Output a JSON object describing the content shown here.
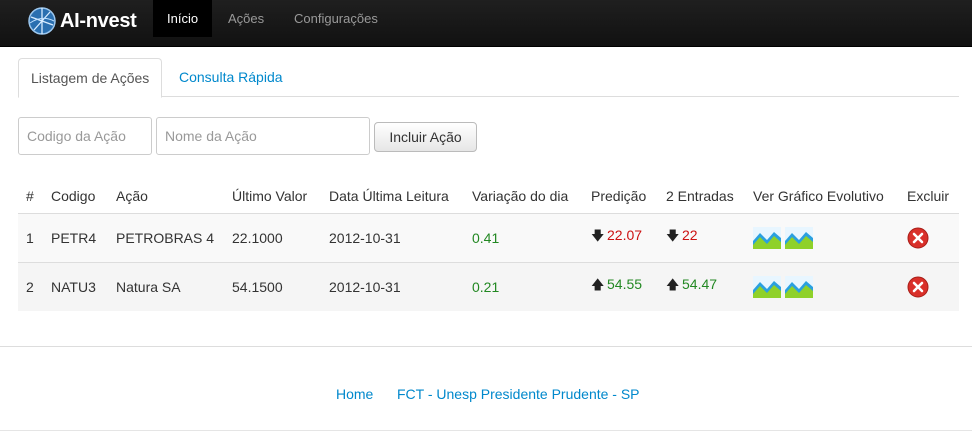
{
  "navbar": {
    "brand": "AI-nvest",
    "items": [
      {
        "label": "Início",
        "active": true
      },
      {
        "label": "Ações",
        "active": false
      },
      {
        "label": "Configurações",
        "active": false
      }
    ]
  },
  "tabs": [
    {
      "label": "Listagem de Ações",
      "active": true
    },
    {
      "label": "Consulta Rápida",
      "active": false
    }
  ],
  "form": {
    "codigo_placeholder": "Codigo da Ação",
    "nome_placeholder": "Nome da Ação",
    "submit_label": "Incluir Ação"
  },
  "table": {
    "headers": [
      "#",
      "Codigo",
      "Ação",
      "Último Valor",
      "Data Última Leitura",
      "Variação do dia",
      "Predição",
      "2 Entradas",
      "Ver Gráfico Evolutivo",
      "Excluir"
    ],
    "rows": [
      {
        "num": "1",
        "codigo": "PETR4",
        "acao": "PETROBRAS 4",
        "ultimo_valor": "22.1000",
        "data": "2012-10-31",
        "variacao": "0.41",
        "predicao": "22.07",
        "predicao_dir": "down",
        "entradas": "22",
        "entradas_dir": "down"
      },
      {
        "num": "2",
        "codigo": "NATU3",
        "acao": "Natura SA",
        "ultimo_valor": "54.1500",
        "data": "2012-10-31",
        "variacao": "0.21",
        "predicao": "54.55",
        "predicao_dir": "up",
        "entradas": "54.47",
        "entradas_dir": "up"
      }
    ]
  },
  "footer": {
    "home": "Home",
    "org": "FCT - Unesp Presidente Prudente - SP"
  },
  "colors": {
    "link": "#0088cc",
    "positive": "#228822",
    "negative": "#cc1111",
    "navbar": "#1b1b1b"
  }
}
